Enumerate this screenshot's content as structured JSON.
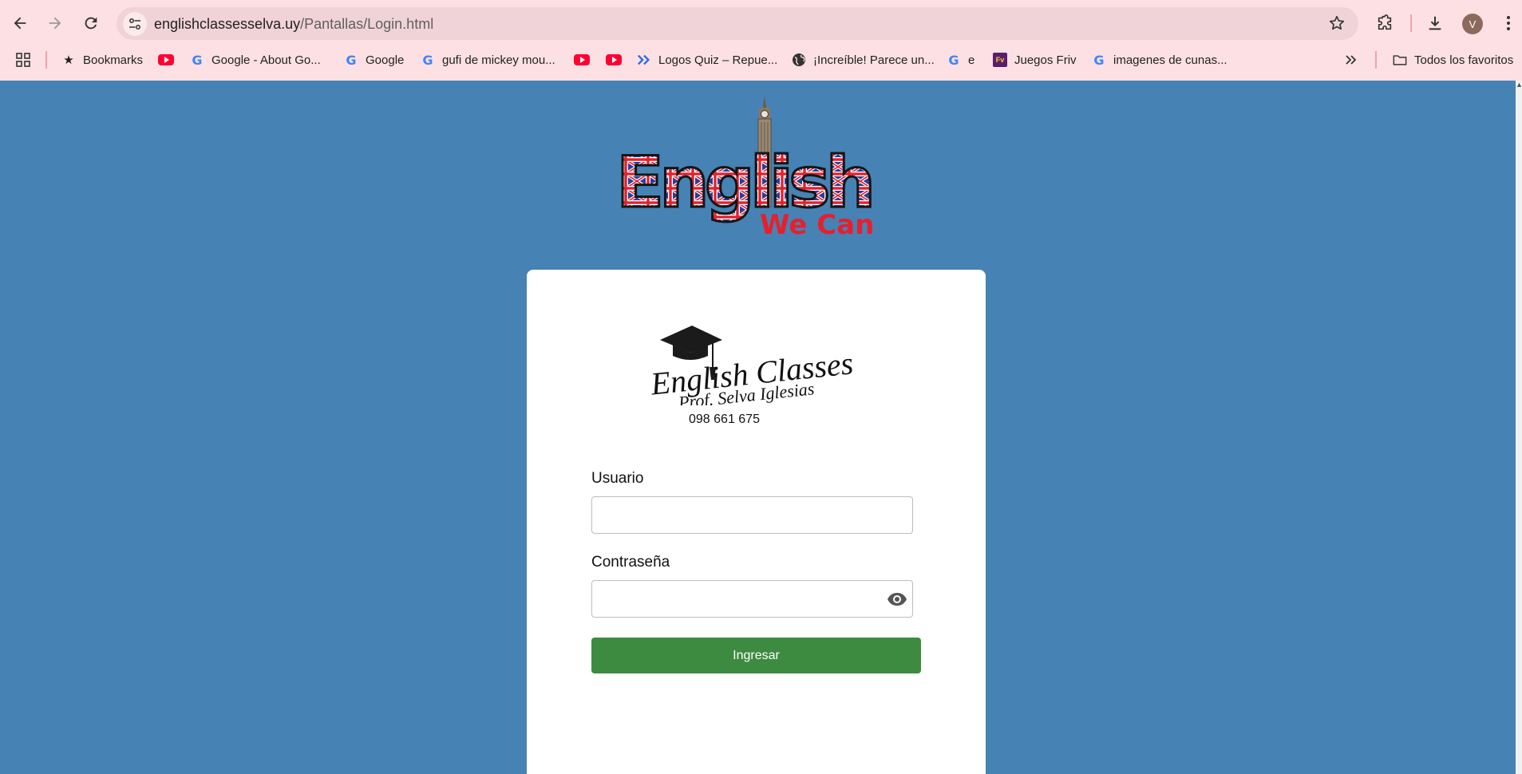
{
  "browser": {
    "url_domain": "englishclassesselva.uy",
    "url_path": "/Pantallas/Login.html",
    "avatar_letter": "V"
  },
  "bookmarks": {
    "items": [
      {
        "label": "Bookmarks",
        "icon": "star-icon"
      },
      {
        "label": "",
        "icon": "youtube-icon"
      },
      {
        "label": "Google - About Go...",
        "icon": "google-icon"
      },
      {
        "label": "Google",
        "icon": "google-icon"
      },
      {
        "label": "gufi de mickey mou...",
        "icon": "google-icon"
      },
      {
        "label": "",
        "icon": "youtube-icon"
      },
      {
        "label": "",
        "icon": "youtube-icon"
      },
      {
        "label": "Logos Quiz – Repue...",
        "icon": "double-chevron-icon"
      },
      {
        "label": "¡Increíble! Parece un...",
        "icon": "globe-icon"
      },
      {
        "label": "e",
        "icon": "google-icon"
      },
      {
        "label": "Juegos Friv",
        "icon": "friv-icon"
      },
      {
        "label": "imagenes de cunas...",
        "icon": "google-icon"
      }
    ],
    "all_bookmarks": "Todos los favoritos"
  },
  "page": {
    "hero_logo_text": "English",
    "hero_logo_subtext": "We Can",
    "card_logo_title": "English Classes",
    "card_logo_subtitle": "Prof. Selva Iglesias",
    "phone": "098 661 675",
    "user_label": "Usuario",
    "user_value": "",
    "password_label": "Contraseña",
    "password_value": "",
    "submit_label": "Ingresar"
  },
  "colors": {
    "page_bg": "#4682b4",
    "chrome_bg": "#fde0e3",
    "button_bg": "#3d8b40",
    "logo_red": "#e5202e",
    "logo_blue": "#2a3f9a"
  }
}
